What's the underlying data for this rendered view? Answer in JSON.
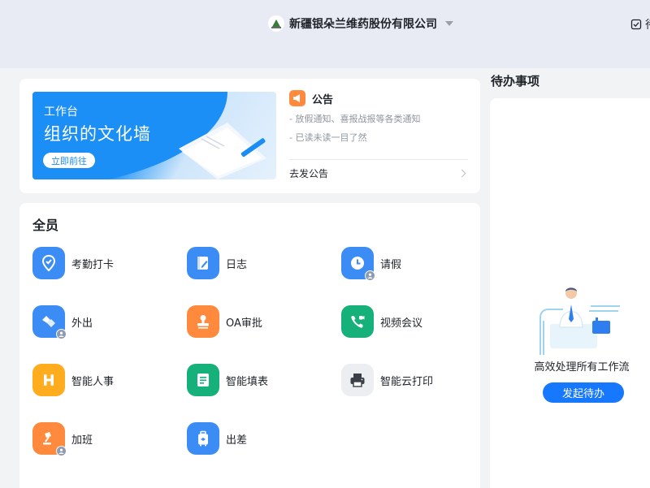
{
  "header": {
    "org_name": "新疆银朵兰维药股份有限公司",
    "right_label": "待"
  },
  "banner": {
    "subtitle": "工作台",
    "title": "组织的文化墙",
    "button_label": "立即前往"
  },
  "notice": {
    "title": "公告",
    "lines": [
      "- 放假通知、喜报战报等各类通知",
      "- 已读未读一目了然"
    ],
    "go_label": "去发公告"
  },
  "apps": {
    "title": "全员",
    "items": [
      {
        "label": "考勤打卡",
        "icon": "location-check-icon",
        "color": "#3b8cf5"
      },
      {
        "label": "日志",
        "icon": "journal-icon",
        "color": "#3b8cf5"
      },
      {
        "label": "请假",
        "icon": "clock-icon",
        "color": "#3b8cf5"
      },
      {
        "label": "外出",
        "icon": "handshake-icon",
        "color": "#3b8cf5"
      },
      {
        "label": "OA审批",
        "icon": "stamp-icon",
        "color": "#ff8a3d"
      },
      {
        "label": "视频会议",
        "icon": "video-phone-icon",
        "color": "#16b07a"
      },
      {
        "label": "智能人事",
        "icon": "h-letter-icon",
        "color": "#ffad1f"
      },
      {
        "label": "智能填表",
        "icon": "form-icon",
        "color": "#16b07a"
      },
      {
        "label": "智能云打印",
        "icon": "printer-icon",
        "color": "#eceef1"
      },
      {
        "label": "加班",
        "icon": "desk-lamp-icon",
        "color": "#ff8a3d"
      },
      {
        "label": "出差",
        "icon": "suitcase-icon",
        "color": "#3b8cf5"
      }
    ]
  },
  "todo": {
    "title": "待办事项",
    "description": "高效处理所有工作流",
    "button_label": "发起待办"
  },
  "colors": {
    "primary": "#1677ff",
    "header_bg": "#e8ebf3",
    "page_bg": "#f2f3f5"
  }
}
